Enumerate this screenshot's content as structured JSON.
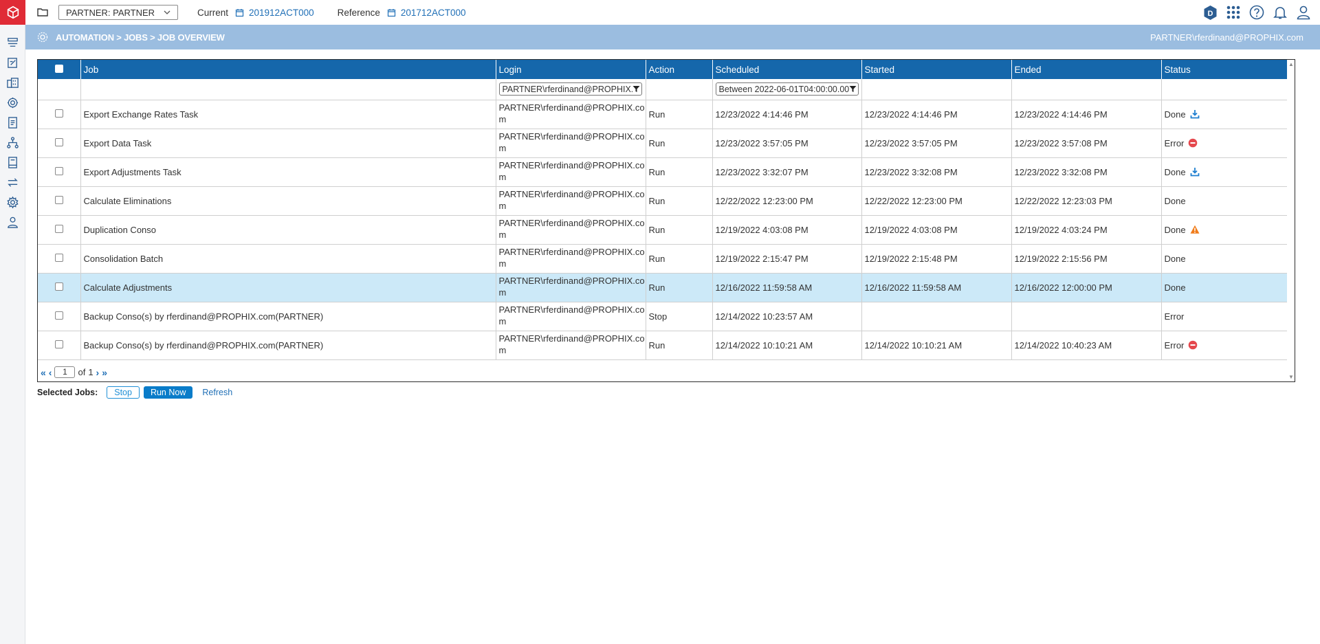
{
  "topbar": {
    "company": "PARTNER: PARTNER",
    "current_label": "Current",
    "current_value": "201912ACT000",
    "reference_label": "Reference",
    "reference_value": "201712ACT000"
  },
  "breadcrumb": "AUTOMATION > JOBS > JOB OVERVIEW",
  "user": "PARTNER\\rferdinand@PROPHIX.com",
  "table": {
    "columns": [
      "Job",
      "Login",
      "Action",
      "Scheduled",
      "Started",
      "Ended",
      "Status"
    ],
    "filters": {
      "login": "PARTNER\\rferdinand@PROPHIX.com",
      "scheduled": "Between 2022-06-01T04:00:00.000"
    },
    "rows": [
      {
        "job": "Export Exchange Rates Task",
        "login": "PARTNER\\rferdinand@PROPHIX.com",
        "action": "Run",
        "scheduled": "12/23/2022 4:14:46 PM",
        "started": "12/23/2022 4:14:46 PM",
        "ended": "12/23/2022 4:14:46 PM",
        "status": "Done",
        "icon": "download-icon"
      },
      {
        "job": "Export Data Task",
        "login": "PARTNER\\rferdinand@PROPHIX.com",
        "action": "Run",
        "scheduled": "12/23/2022 3:57:05 PM",
        "started": "12/23/2022 3:57:05 PM",
        "ended": "12/23/2022 3:57:08 PM",
        "status": "Error",
        "icon": "error-icon"
      },
      {
        "job": "Export Adjustments Task",
        "login": "PARTNER\\rferdinand@PROPHIX.com",
        "action": "Run",
        "scheduled": "12/23/2022 3:32:07 PM",
        "started": "12/23/2022 3:32:08 PM",
        "ended": "12/23/2022 3:32:08 PM",
        "status": "Done",
        "icon": "download-icon"
      },
      {
        "job": "Calculate Eliminations",
        "login": "PARTNER\\rferdinand@PROPHIX.com",
        "action": "Run",
        "scheduled": "12/22/2022 12:23:00 PM",
        "started": "12/22/2022 12:23:00 PM",
        "ended": "12/22/2022 12:23:03 PM",
        "status": "Done",
        "icon": ""
      },
      {
        "job": "Duplication Conso",
        "login": "PARTNER\\rferdinand@PROPHIX.com",
        "action": "Run",
        "scheduled": "12/19/2022 4:03:08 PM",
        "started": "12/19/2022 4:03:08 PM",
        "ended": "12/19/2022 4:03:24 PM",
        "status": "Done",
        "icon": "warning-icon"
      },
      {
        "job": "Consolidation Batch",
        "login": "PARTNER\\rferdinand@PROPHIX.com",
        "action": "Run",
        "scheduled": "12/19/2022 2:15:47 PM",
        "started": "12/19/2022 2:15:48 PM",
        "ended": "12/19/2022 2:15:56 PM",
        "status": "Done",
        "icon": ""
      },
      {
        "job": "Calculate Adjustments",
        "login": "PARTNER\\rferdinand@PROPHIX.com",
        "action": "Run",
        "scheduled": "12/16/2022 11:59:58 AM",
        "started": "12/16/2022 11:59:58 AM",
        "ended": "12/16/2022 12:00:00 PM",
        "status": "Done",
        "icon": "",
        "selected": true
      },
      {
        "job": "Backup Conso(s) by rferdinand@PROPHIX.com(PARTNER)",
        "login": "PARTNER\\rferdinand@PROPHIX.com",
        "action": "Stop",
        "scheduled": "12/14/2022 10:23:57 AM",
        "started": "",
        "ended": "",
        "status": "Error",
        "icon": ""
      },
      {
        "job": "Backup Conso(s) by rferdinand@PROPHIX.com(PARTNER)",
        "login": "PARTNER\\rferdinand@PROPHIX.com",
        "action": "Run",
        "scheduled": "12/14/2022 10:10:21 AM",
        "started": "12/14/2022 10:10:21 AM",
        "ended": "12/14/2022 10:40:23 AM",
        "status": "Error",
        "icon": "error-icon"
      }
    ]
  },
  "pager": {
    "page": "1",
    "of_label": "of",
    "total": "1"
  },
  "actions": {
    "label": "Selected Jobs:",
    "stop": "Stop",
    "run_now": "Run Now",
    "refresh": "Refresh"
  },
  "colors": {
    "header_blue": "#1567ab",
    "crumb_bar": "#9bbde0",
    "selected_row": "#cce9f8",
    "error": "#e5484d",
    "warning": "#f07c1a",
    "link": "#1f6fb6",
    "logo_red": "#e02b36"
  }
}
